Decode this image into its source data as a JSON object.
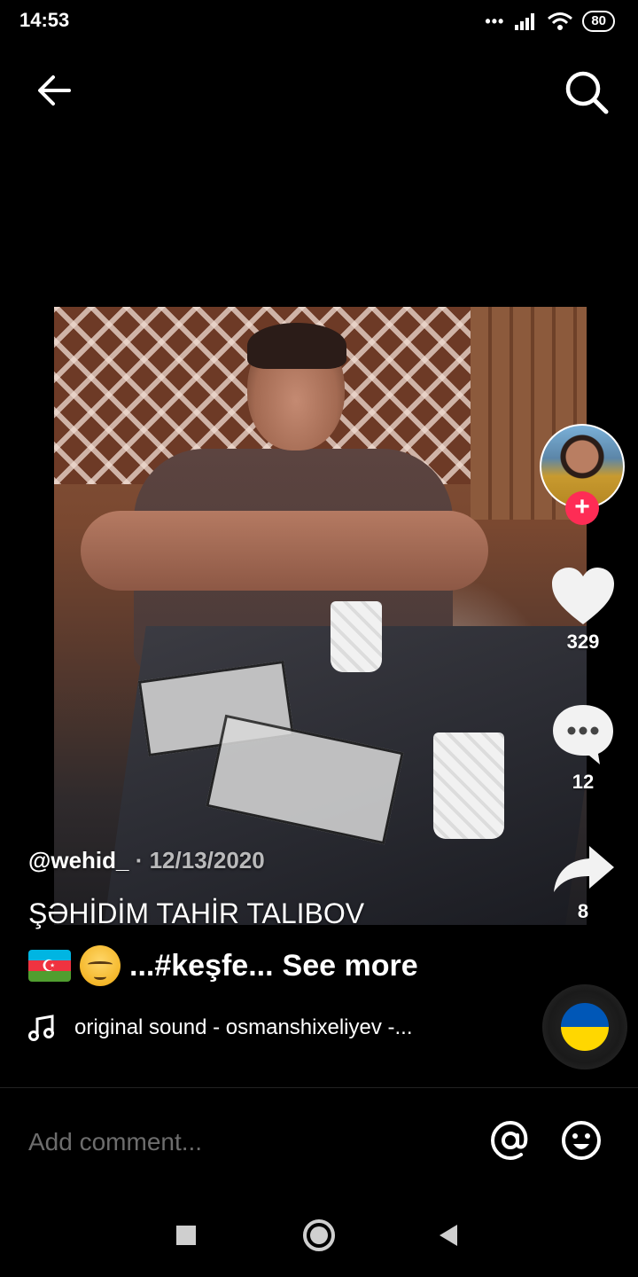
{
  "status_bar": {
    "time": "14:53",
    "signal_dots": "•••",
    "battery": "80",
    "icons": [
      "signal-icon",
      "wifi-icon",
      "battery-icon"
    ]
  },
  "top_nav": {
    "icons": [
      "back-arrow-icon",
      "search-icon"
    ]
  },
  "video": {
    "description_icon": "video-frame"
  },
  "side_actions": {
    "likes": "329",
    "comments": "12",
    "shares": "8",
    "follow_symbol": "+"
  },
  "caption": {
    "username": "@wehid_",
    "separator": " · ",
    "date": "12/13/2020",
    "line1": "ŞƏHİDİM TAHİR TALIBOV",
    "hashtag_text": "...#keşfe...",
    "see_more": "See more"
  },
  "sound": {
    "text": "original sound - osmanshixeliyev -..."
  },
  "comment_bar": {
    "placeholder": "Add comment..."
  },
  "colors": {
    "follow_accent": "#fe2c55",
    "background": "#000000"
  }
}
